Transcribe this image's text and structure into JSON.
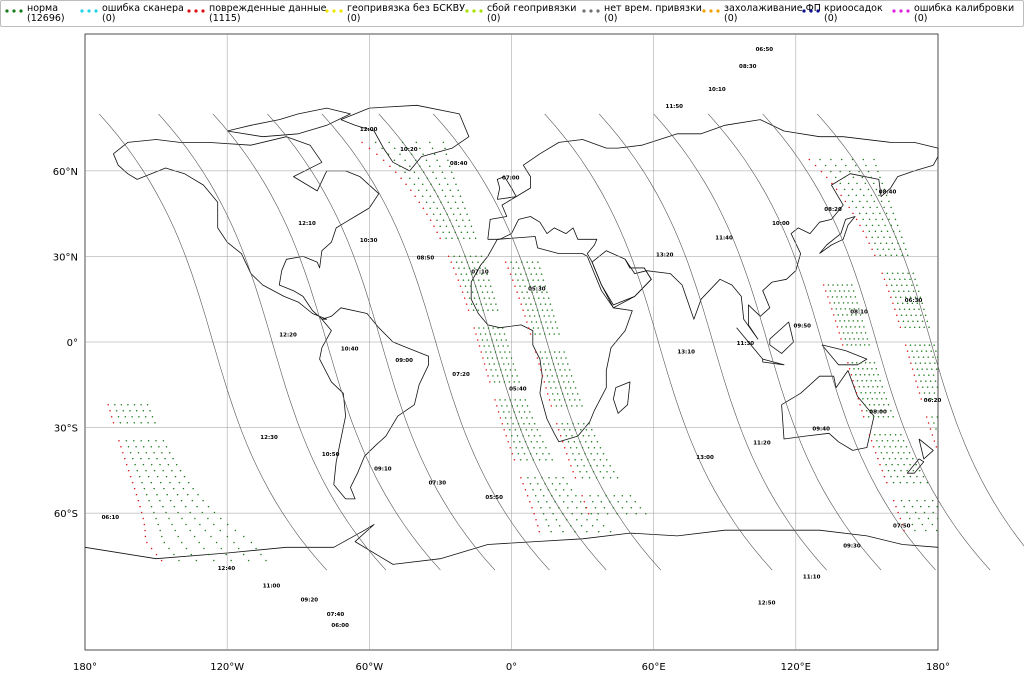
{
  "legend": [
    {
      "id": "norm",
      "label": "норма",
      "count": "(12696)",
      "color": "#1a7a1a"
    },
    {
      "id": "scanner",
      "label": "ошибка сканера",
      "count": "(0)",
      "color": "#22d3e6"
    },
    {
      "id": "damaged",
      "label": "поврежденные данные",
      "count": "(1115)",
      "color": "#e01010"
    },
    {
      "id": "geo_nobskvu",
      "label": "геопривязка без БСКВУ",
      "count": "(0)",
      "color": "#f2e600"
    },
    {
      "id": "geo_fail",
      "label": "сбой геопривязки",
      "count": "(0)",
      "color": "#a8e000"
    },
    {
      "id": "no_time",
      "label": "нет врем. привязки",
      "count": "(0)",
      "color": "#707070"
    },
    {
      "id": "fp_cool",
      "label": "захолаживание ФП",
      "count": "(0)",
      "color": "#f0a000"
    },
    {
      "id": "cryo",
      "label": "криоосадок",
      "count": "(0)",
      "color": "#0a1090"
    },
    {
      "id": "calib",
      "label": "ошибка калибровки",
      "count": "(0)",
      "color": "#e020e0"
    }
  ],
  "map": {
    "projection": "equirectangular",
    "lon_range": [
      -180,
      180
    ],
    "lat_range": [
      -90,
      90
    ],
    "x_ticks": [
      {
        "lon": -180,
        "label": "180°"
      },
      {
        "lon": -120,
        "label": "120°W"
      },
      {
        "lon": -60,
        "label": "60°W"
      },
      {
        "lon": 0,
        "label": "0°"
      },
      {
        "lon": 60,
        "label": "60°E"
      },
      {
        "lon": 120,
        "label": "120°E"
      },
      {
        "lon": 180,
        "label": "180°"
      }
    ],
    "y_ticks": [
      {
        "lat": 60,
        "label": "60°N"
      },
      {
        "lat": 30,
        "label": "30°N"
      },
      {
        "lat": 0,
        "label": "0°"
      },
      {
        "lat": -30,
        "label": "30°S"
      },
      {
        "lat": -60,
        "label": "60°S"
      }
    ],
    "grid_lons": [
      -120,
      -60,
      0,
      60,
      120
    ],
    "grid_lats": [
      60,
      30,
      0,
      -30,
      -60
    ],
    "time_labels": [
      {
        "t": "12:00",
        "lon": -64,
        "lat": 74
      },
      {
        "t": "10:20",
        "lon": -47,
        "lat": 67
      },
      {
        "t": "08:40",
        "lon": -26,
        "lat": 62
      },
      {
        "t": "07:00",
        "lon": -4,
        "lat": 57
      },
      {
        "t": "12:10",
        "lon": -90,
        "lat": 41
      },
      {
        "t": "10:30",
        "lon": -64,
        "lat": 35
      },
      {
        "t": "08:50",
        "lon": -40,
        "lat": 29
      },
      {
        "t": "07:10",
        "lon": -17,
        "lat": 24
      },
      {
        "t": "05:30",
        "lon": 7,
        "lat": 18
      },
      {
        "t": "12:20",
        "lon": -98,
        "lat": 2
      },
      {
        "t": "10:40",
        "lon": -72,
        "lat": -3
      },
      {
        "t": "09:00",
        "lon": -49,
        "lat": -7
      },
      {
        "t": "07:20",
        "lon": -25,
        "lat": -12
      },
      {
        "t": "05:40",
        "lon": -1,
        "lat": -17
      },
      {
        "t": "12:30",
        "lon": -106,
        "lat": -34
      },
      {
        "t": "10:50",
        "lon": -80,
        "lat": -40
      },
      {
        "t": "09:10",
        "lon": -58,
        "lat": -45
      },
      {
        "t": "07:30",
        "lon": -35,
        "lat": -50
      },
      {
        "t": "05:50",
        "lon": -11,
        "lat": -55
      },
      {
        "t": "06:10",
        "lon": -173,
        "lat": -62
      },
      {
        "t": "12:40",
        "lon": -124,
        "lat": -80
      },
      {
        "t": "11:00",
        "lon": -105,
        "lat": -86
      },
      {
        "t": "09:20",
        "lon": -89,
        "lat": -91
      },
      {
        "t": "07:40",
        "lon": -78,
        "lat": -96
      },
      {
        "t": "06:00",
        "lon": -76,
        "lat": -100
      },
      {
        "t": "06:50",
        "lon": 103,
        "lat": 102
      },
      {
        "t": "08:30",
        "lon": 96,
        "lat": 96
      },
      {
        "t": "10:10",
        "lon": 83,
        "lat": 88
      },
      {
        "t": "11:50",
        "lon": 65,
        "lat": 82
      },
      {
        "t": "08:40",
        "lon": 155,
        "lat": 52
      },
      {
        "t": "08:20",
        "lon": 132,
        "lat": 46
      },
      {
        "t": "10:00",
        "lon": 110,
        "lat": 41
      },
      {
        "t": "11:40",
        "lon": 86,
        "lat": 36
      },
      {
        "t": "13:20",
        "lon": 61,
        "lat": 30
      },
      {
        "t": "08:10",
        "lon": 143,
        "lat": 10
      },
      {
        "t": "06:30",
        "lon": 166,
        "lat": 14
      },
      {
        "t": "09:50",
        "lon": 119,
        "lat": 5
      },
      {
        "t": "11:30",
        "lon": 95,
        "lat": -1
      },
      {
        "t": "13:10",
        "lon": 70,
        "lat": -4
      },
      {
        "t": "08:00",
        "lon": 151,
        "lat": -25
      },
      {
        "t": "06:20",
        "lon": 174,
        "lat": -21
      },
      {
        "t": "09:40",
        "lon": 127,
        "lat": -31
      },
      {
        "t": "11:20",
        "lon": 102,
        "lat": -36
      },
      {
        "t": "13:00",
        "lon": 78,
        "lat": -41
      },
      {
        "t": "07:50",
        "lon": 161,
        "lat": -65
      },
      {
        "t": "09:30",
        "lon": 140,
        "lat": -72
      },
      {
        "t": "11:10",
        "lon": 123,
        "lat": -83
      },
      {
        "t": "12:50",
        "lon": 104,
        "lat": -92
      }
    ]
  }
}
